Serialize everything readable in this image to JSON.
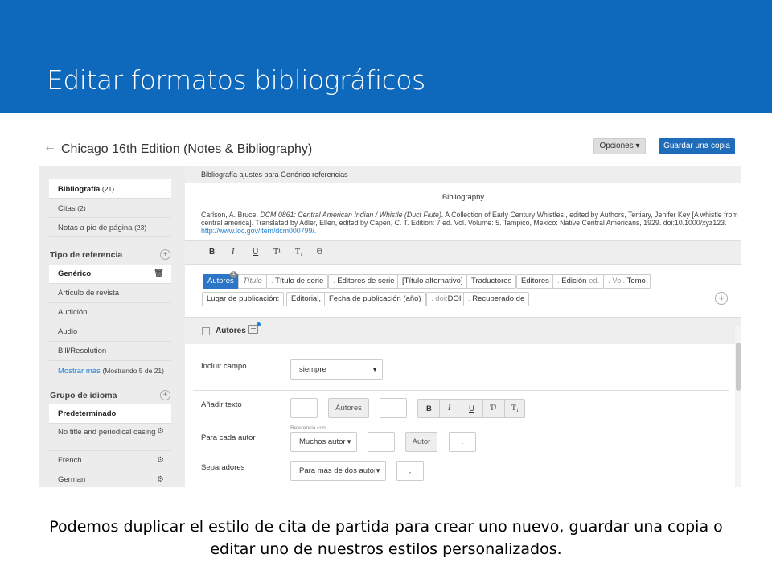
{
  "slide": {
    "title": "Editar formatos bibliográficos",
    "caption": "Podemos duplicar el estilo de cita de partida para crear uno nuevo, guardar una copia o editar uno de nuestros estilos personalizados."
  },
  "header": {
    "back_icon": "←",
    "style_title": "Chicago 16th Edition (Notes & Bibliography)",
    "options_label": "Opciones ▾",
    "save_copy_label": "Guardar una copia"
  },
  "sidebar": {
    "sections": [
      {
        "label": "Bibliografía",
        "count": "(21)"
      },
      {
        "label": "Citas",
        "count": "(2)"
      },
      {
        "label": "Notas a pie de página",
        "count": "(23)"
      }
    ],
    "ref_type_heading": "Tipo de referencia",
    "ref_types": [
      "Genérico",
      "Artículo de revista",
      "Audición",
      "Audio",
      "Bill/Resolution"
    ],
    "show_more": {
      "label": "Mostrar más",
      "count": "(Mostrando 5 de 21)"
    },
    "lang_heading": "Grupo de idioma",
    "languages": [
      "Predeterminado",
      "No title and periodical casing",
      "French",
      "German"
    ],
    "plus_icon": "+",
    "trash_icon": "🗑",
    "gear_icon": "⚙"
  },
  "main": {
    "settings_bar": "Bibliografía ajustes para Genérico referencias",
    "preview_title": "Bibliography",
    "preview": {
      "part1": "Carlson, A. Bruce. ",
      "part2_italic": "DCM 0861: Central American Indian / Whistle (Duct Flute)",
      "part3": ". A Collection of Early Century Whistles., edited by Authors, Tertiary, Jenifer Key [A whistle from central america]. Translated by Adler, Ellen, edited by Capen, C. T. Edition: 7 ed. Vol. Volume: 5. Tampico, Mexico: Native Central Americans, 1929. doi:10.1000/xyz123. ",
      "url": "http://www.loc.gov/item/dcm000799/."
    },
    "format_buttons": [
      "B",
      "I",
      "U",
      "T¹",
      "T₁",
      "⧉"
    ],
    "tokens_row1": [
      {
        "label": "Autores"
      },
      {
        "label": "Título"
      },
      {
        "pre": ".",
        "label": "Título de serie"
      },
      {
        "pre": ".",
        "label": "Editores de serie"
      },
      {
        "label": "[Título alternativo]"
      },
      {
        "label": "Traductores"
      },
      {
        "label": "Editores"
      },
      {
        "pre": ".",
        "label": "Edición",
        "post": "ed."
      },
      {
        "pre": ". Vol.",
        "label": "Tomo"
      }
    ],
    "tokens_row2": [
      {
        "label": "Lugar de publicación:"
      },
      {
        "label": "Editorial,"
      },
      {
        "label": "Fecha de publicación (año)"
      },
      {
        "pre": ". doi:",
        "label": "DOI"
      },
      {
        "pre": ".",
        "label": "Recuperado de"
      }
    ],
    "badge": "1",
    "section_title": "Autores",
    "collapse": "−",
    "fields": {
      "include_label": "Incluir campo",
      "include_value": "siempre",
      "add_text_label": "Añadir texto",
      "add_text_token": "Autores",
      "fmt_group": [
        "B",
        "I",
        "U",
        "T¹",
        "T₁"
      ],
      "per_author_label": "Para cada autor",
      "per_author_hint": "Referencia con",
      "per_author_value": "Muchos autores",
      "per_author_token": "Autor",
      "per_author_sep": ".",
      "separators_label": "Separadores",
      "separators_value": "Para más de dos autores",
      "separators_sep": ","
    }
  }
}
